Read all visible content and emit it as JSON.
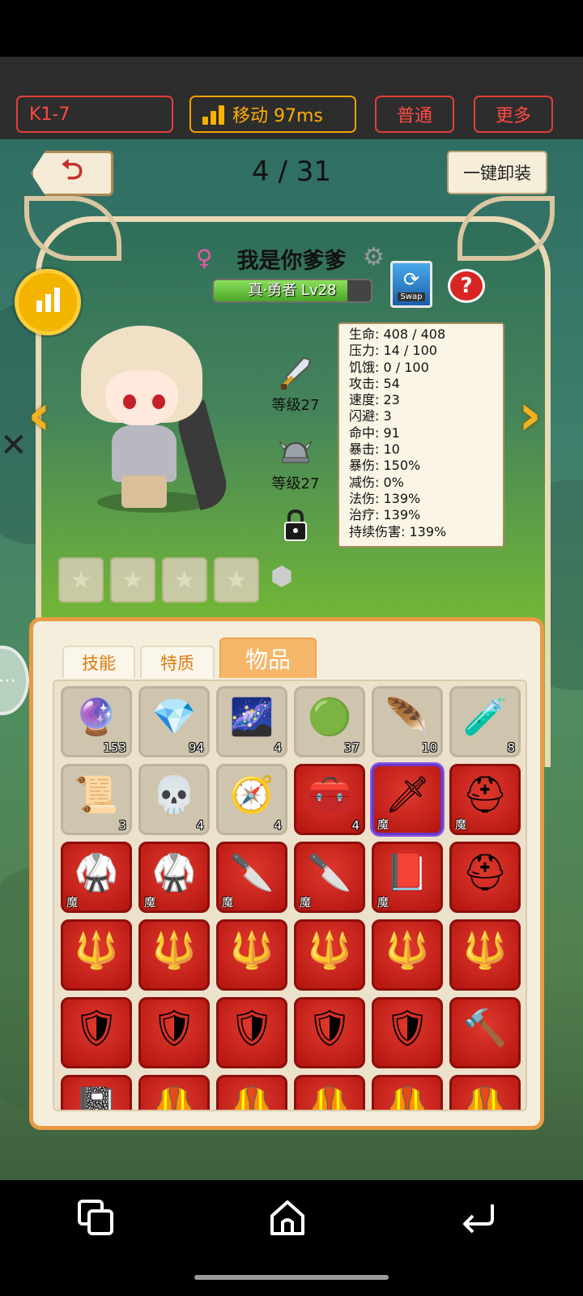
{
  "topbar": {
    "server": "K1-7",
    "ping": "移动 97ms",
    "mode": "普通",
    "more": "更多"
  },
  "header": {
    "page_count": "4 / 31",
    "unequip_label": "一键卸装"
  },
  "hero": {
    "name": "我是你爹爹",
    "class_level": "真·勇者 Lv28",
    "class_progress": 0.85,
    "swap_label": "Swap",
    "help": "?",
    "weapon_level": "等级27",
    "helmet_level": "等级27"
  },
  "stats": [
    "生命: 408 / 408",
    "压力: 14 / 100",
    "饥饿: 0 / 100",
    "攻击: 54",
    "速度: 23",
    "闪避: 3",
    "命中: 91",
    "暴击: 10",
    "暴伤: 150%",
    "减伤: 0%",
    "法伤: 139%",
    "治疗: 139%",
    "持续伤害: 139%"
  ],
  "tabs": {
    "skills": "技能",
    "traits": "特质",
    "items": "物品"
  },
  "items": [
    {
      "icon": "purple-orb-icon",
      "glyph": "🔮",
      "qty": "153",
      "red": false
    },
    {
      "icon": "amethyst-icon",
      "glyph": "💎",
      "qty": "94",
      "red": false
    },
    {
      "icon": "dark-orb-icon",
      "glyph": "🌌",
      "qty": "4",
      "red": false
    },
    {
      "icon": "emerald-icon",
      "glyph": "🟢",
      "qty": "37",
      "red": false
    },
    {
      "icon": "phoenix-feather-icon",
      "glyph": "🪶",
      "qty": "10",
      "red": false
    },
    {
      "icon": "potion-icon",
      "glyph": "🧪",
      "qty": "8",
      "red": false
    },
    {
      "icon": "scroll-icon",
      "glyph": "📜",
      "qty": "3",
      "red": false
    },
    {
      "icon": "skull-bag-icon",
      "glyph": "💀",
      "qty": "4",
      "red": false
    },
    {
      "icon": "compass-icon",
      "glyph": "🧭",
      "qty": "4",
      "red": false
    },
    {
      "icon": "treasure-chest-icon",
      "glyph": "🧰",
      "qty": "4",
      "red": true
    },
    {
      "icon": "magic-sword-icon",
      "glyph": "🗡",
      "magic": "魔",
      "red": true,
      "selected": true
    },
    {
      "icon": "gold-helmet-icon",
      "glyph": "⛑",
      "magic": "魔",
      "red": true
    },
    {
      "icon": "fur-armor-icon",
      "glyph": "🥋",
      "magic": "魔",
      "red": true
    },
    {
      "icon": "fur-armor-icon",
      "glyph": "🥋",
      "magic": "魔",
      "red": true
    },
    {
      "icon": "curved-blade-icon",
      "glyph": "🔪",
      "magic": "魔",
      "red": true
    },
    {
      "icon": "curved-blade-icon",
      "glyph": "🔪",
      "magic": "魔",
      "red": true
    },
    {
      "icon": "spellbook-icon",
      "glyph": "📕",
      "magic": "魔",
      "red": true
    },
    {
      "icon": "gold-helmet-icon",
      "glyph": "⛑",
      "red": true
    },
    {
      "icon": "winged-mace-icon",
      "glyph": "🔱",
      "red": true
    },
    {
      "icon": "winged-mace-icon",
      "glyph": "🔱",
      "red": true
    },
    {
      "icon": "winged-mace-icon",
      "glyph": "🔱",
      "red": true
    },
    {
      "icon": "winged-mace-icon",
      "glyph": "🔱",
      "red": true
    },
    {
      "icon": "winged-mace-icon",
      "glyph": "🔱",
      "red": true
    },
    {
      "icon": "winged-mace-icon",
      "glyph": "🔱",
      "red": true
    },
    {
      "icon": "laurel-shield-icon",
      "glyph": "🛡",
      "red": true
    },
    {
      "icon": "laurel-shield-icon",
      "glyph": "🛡",
      "red": true
    },
    {
      "icon": "laurel-shield-icon",
      "glyph": "🛡",
      "red": true
    },
    {
      "icon": "laurel-shield-icon",
      "glyph": "🛡",
      "red": true
    },
    {
      "icon": "laurel-shield-icon",
      "glyph": "🛡",
      "red": true
    },
    {
      "icon": "hammer-icon",
      "glyph": "🔨",
      "red": true
    },
    {
      "icon": "book-icon",
      "glyph": "📓",
      "red": true
    },
    {
      "icon": "gold-armor-icon",
      "glyph": "🦺",
      "red": true
    },
    {
      "icon": "gold-armor-icon",
      "glyph": "🦺",
      "red": true
    },
    {
      "icon": "gold-armor-icon",
      "glyph": "🦺",
      "red": true
    },
    {
      "icon": "gold-armor-icon",
      "glyph": "🦺",
      "red": true
    },
    {
      "icon": "gold-armor-icon",
      "glyph": "🦺",
      "red": true
    }
  ]
}
